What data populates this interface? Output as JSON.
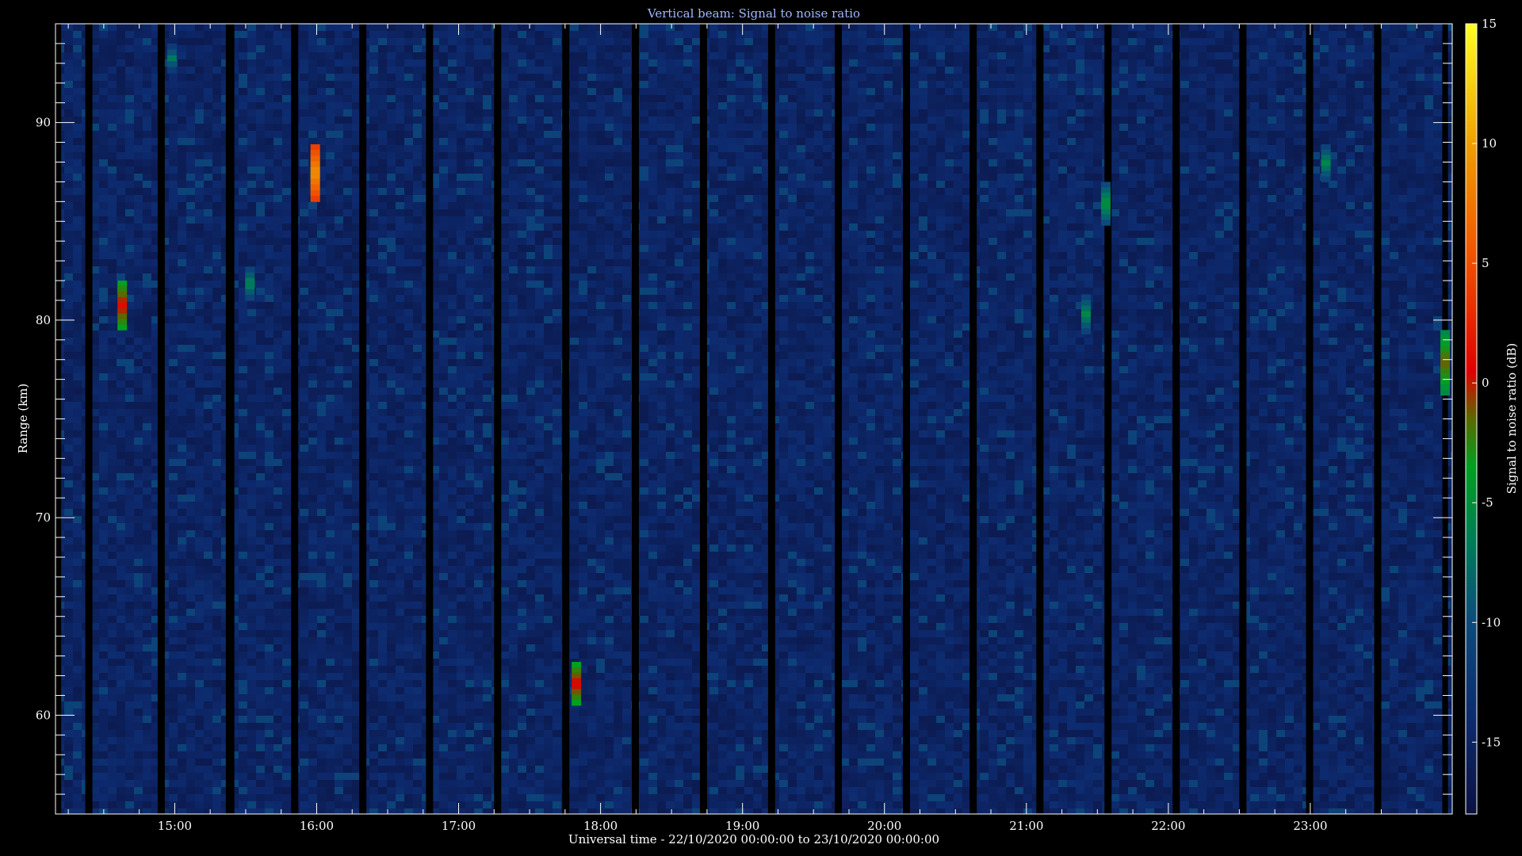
{
  "chart_data": {
    "type": "heatmap",
    "title": "Vertical beam: Signal to noise ratio",
    "xlabel": "Universal time - 22/10/2020 00:00:00 to 23/10/2020 00:00:00",
    "ylabel": "Range (km)",
    "colorbar_label": "Signal to noise ratio (dB)",
    "x_unit": "hours UT",
    "xlim": [
      14.16,
      24.0
    ],
    "ylim": [
      55.0,
      95.0
    ],
    "zlim": [
      -18.0,
      15.0
    ],
    "x_tick_labels": [
      "15:00",
      "16:00",
      "17:00",
      "18:00",
      "19:00",
      "20:00",
      "21:00",
      "22:00",
      "23:00"
    ],
    "x_ticks": [
      15,
      16,
      17,
      18,
      19,
      20,
      21,
      22,
      23
    ],
    "y_ticks": [
      60,
      70,
      80,
      90
    ],
    "y_tick_labels": [
      "60",
      "70",
      "80",
      "90"
    ],
    "colorbar_ticks": [
      15,
      10,
      5,
      0,
      -5,
      -10,
      -15
    ],
    "colorbar_tick_labels": [
      "15",
      "10",
      "5",
      "0",
      "-5",
      "-10",
      "-15"
    ],
    "background_snr_db": -15,
    "data_gaps_hours": [
      [
        14.16,
        14.2
      ],
      [
        14.37,
        14.42
      ],
      [
        14.88,
        14.93
      ],
      [
        15.36,
        15.42
      ],
      [
        15.82,
        15.87
      ],
      [
        16.3,
        16.35
      ],
      [
        16.77,
        16.82
      ],
      [
        17.25,
        17.3
      ],
      [
        17.73,
        17.78
      ],
      [
        18.22,
        18.27
      ],
      [
        18.7,
        18.75
      ],
      [
        19.18,
        19.23
      ],
      [
        19.65,
        19.7
      ],
      [
        20.13,
        20.18
      ],
      [
        20.6,
        20.65
      ],
      [
        21.07,
        21.12
      ],
      [
        21.55,
        21.6
      ],
      [
        22.03,
        22.08
      ],
      [
        22.5,
        22.55
      ],
      [
        22.97,
        23.02
      ],
      [
        23.45,
        23.5
      ],
      [
        23.93,
        23.97
      ]
    ],
    "echoes": [
      {
        "time": 14.63,
        "range_from": 79.5,
        "range_to": 82.0,
        "snr_db": 1
      },
      {
        "time": 14.98,
        "range_from": 92.5,
        "range_to": 94.0,
        "snr_db": -7
      },
      {
        "time": 15.53,
        "range_from": 81.0,
        "range_to": 82.7,
        "snr_db": -6
      },
      {
        "time": 15.99,
        "range_from": 86.0,
        "range_to": 88.9,
        "snr_db": 9
      },
      {
        "time": 17.83,
        "range_from": 60.5,
        "range_to": 62.7,
        "snr_db": 1
      },
      {
        "time": 21.42,
        "range_from": 79.3,
        "range_to": 81.3,
        "snr_db": -6
      },
      {
        "time": 21.56,
        "range_from": 84.8,
        "range_to": 87.0,
        "snr_db": -5
      },
      {
        "time": 23.11,
        "range_from": 87.0,
        "range_to": 88.9,
        "snr_db": -6
      },
      {
        "time": 23.95,
        "range_from": 76.2,
        "range_to": 79.5,
        "snr_db": -1
      }
    ]
  }
}
